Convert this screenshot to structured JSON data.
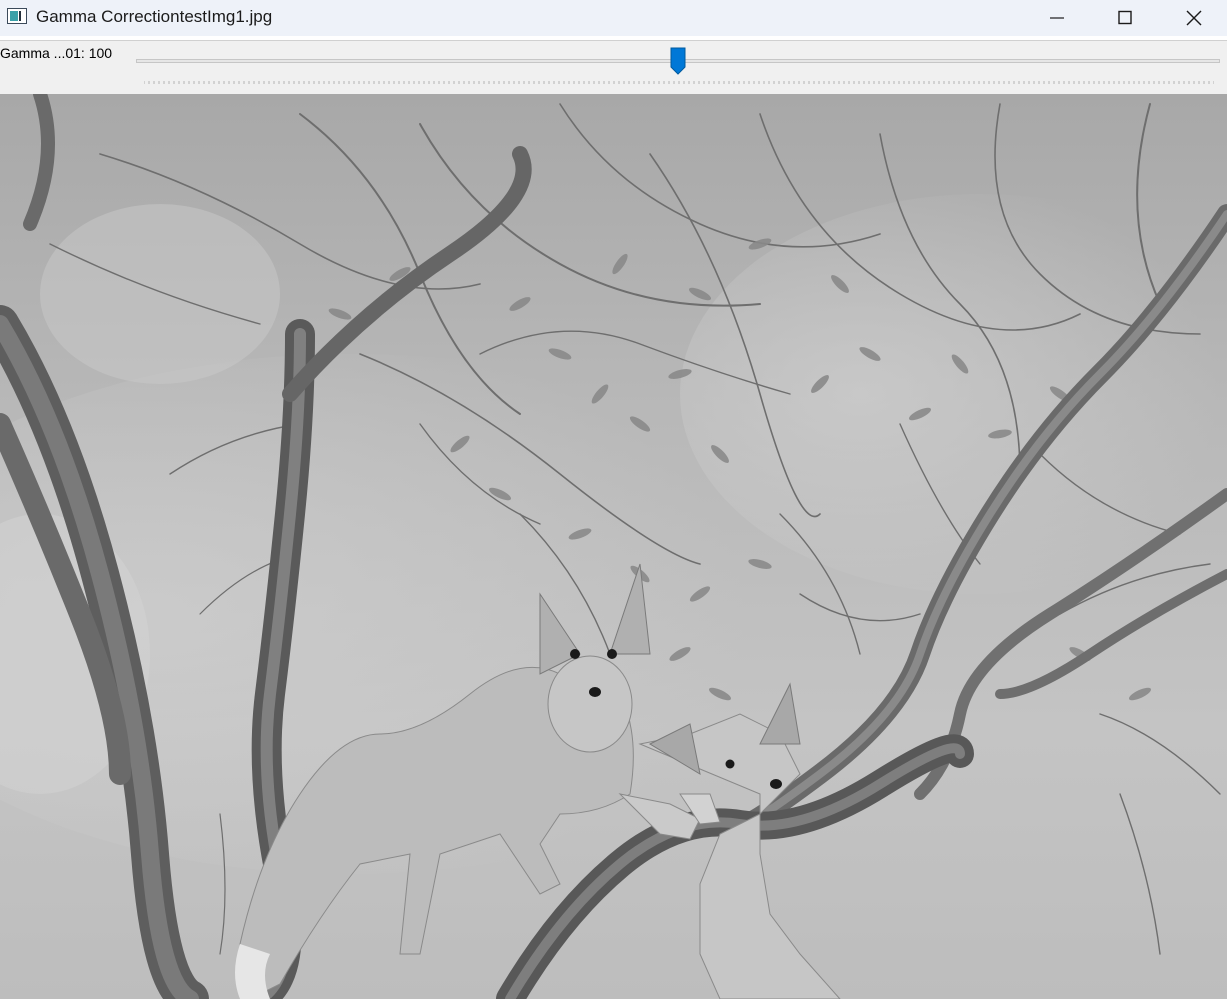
{
  "window": {
    "title": "Gamma CorrectiontestImg1.jpg",
    "icon": "app-window-icon",
    "controls": [
      "minimize-icon",
      "maximize-icon",
      "close-icon"
    ]
  },
  "trackbar": {
    "label": "Gamma ...01: 100",
    "value": 100,
    "fraction": 0.5,
    "accent_color": "#0078d7"
  },
  "image": {
    "content": "grayscale photograph",
    "palette": [
      "#9d9d9d",
      "#bdbdbd",
      "#6f6f6f",
      "#d8d8d8"
    ]
  }
}
